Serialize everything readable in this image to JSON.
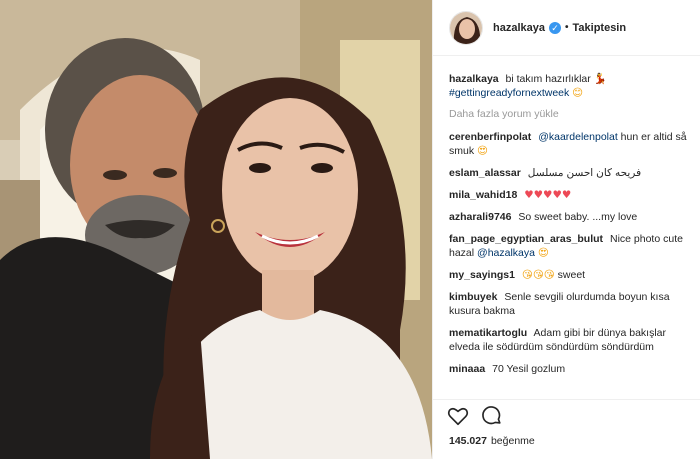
{
  "post": {
    "username": "hazalkaya",
    "verified_badge": "✓",
    "separator": "•",
    "follow_label": "Takiptesin",
    "caption_text": "bi takım hazırlıklar",
    "caption_emoji": "💃",
    "caption_hashtag": "#gettingreadyfornextweek",
    "caption_emoji2": "😊",
    "load_more": "Daha fazla yorum yükle",
    "likes_count": "145.027",
    "likes_label": "beğenme"
  },
  "comments": [
    {
      "user": "cerenberfinpolat",
      "mention": "@kaardelenpolat",
      "text": "hun er altid så smuk",
      "emoji": "😍"
    },
    {
      "user": "eslam_alassar",
      "text": "فريحه كان احسن مسلسل"
    },
    {
      "user": "mila_wahid18",
      "emoji": "♥♥♥♥♥"
    },
    {
      "user": "azharali9746",
      "text": "So sweet baby. ...my love"
    },
    {
      "user": "fan_page_egyptian_aras_bulut",
      "text": "Nice photo cute hazal",
      "mention": "@hazalkaya",
      "emoji": "😍"
    },
    {
      "user": "my_sayings1",
      "emoji": "😘😘😘",
      "text": "sweet"
    },
    {
      "user": "kimbuyek",
      "text": "Senle sevgili olurdumda boyun kısa kusura bakma"
    },
    {
      "user": "mematikartoglu",
      "text": "Adam gibi bir dünya bakışlar elveda ile södürdüm söndürdüm söndürdüm"
    },
    {
      "user": "minaaa",
      "text": "70 Yesil gozlum"
    }
  ],
  "icons": {
    "like": "heart-outline-icon",
    "comment": "speech-bubble-icon"
  },
  "colors": {
    "verified": "#3897f0",
    "link": "#003569",
    "muted": "#999999",
    "heart": "#ed4956"
  }
}
